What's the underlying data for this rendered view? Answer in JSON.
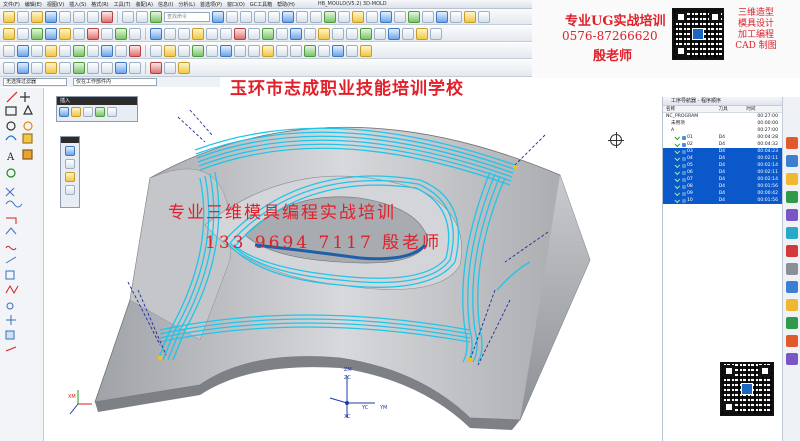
{
  "menubar": {
    "items": [
      "文件(F)",
      "编辑(E)",
      "视图(V)",
      "插入(S)",
      "格式(R)",
      "工具(T)",
      "装配(A)",
      "信息(I)",
      "分析(L)",
      "首选项(P)",
      "窗口(O)",
      "GC工具箱",
      "帮助(H)"
    ],
    "window_title": "HB_MOULD(V5.2)   3D-MOLD"
  },
  "toolbar": {
    "search_placeholder": "查找命令"
  },
  "filter": {
    "selection_filter": "无选择过滤器",
    "scope": "仅在工作部件内"
  },
  "banner": {
    "title": "专业UG实战培训",
    "phone": "0576-87266620",
    "name": "殷老师",
    "tags": [
      "三维造型",
      "模具设计",
      "加工编程",
      "CAD 制图"
    ]
  },
  "viewport": {
    "school_name": "玉环市志成职业技能培训学校",
    "watermark_line1": "专业三维模具编程实战培训",
    "watermark_line2": "133 9694 7117 殷老师",
    "axes": {
      "zm": "ZM",
      "zc": "ZC",
      "yc": "YC",
      "ym": "YM",
      "xc": "XC",
      "xm": "XM"
    }
  },
  "palette": {
    "title": "插入"
  },
  "navigator": {
    "title": "工序导航器 - 程序顺序",
    "columns": {
      "name": "名称",
      "tool": "刀具",
      "time": "时间"
    },
    "rows": [
      {
        "name": "NC_PROGRAM",
        "tool": "",
        "time": "00:27:00",
        "selected": false,
        "indent": 0
      },
      {
        "name": "未用项",
        "tool": "",
        "time": "00:00:00",
        "selected": false,
        "indent": 1
      },
      {
        "name": "A",
        "tool": "",
        "time": "00:27:00",
        "selected": false,
        "indent": 1
      },
      {
        "name": "01",
        "tool": "D4",
        "time": "00:04:28",
        "selected": false,
        "indent": 2
      },
      {
        "name": "02",
        "tool": "D4",
        "time": "00:04:32",
        "selected": false,
        "indent": 2
      },
      {
        "name": "03",
        "tool": "D4",
        "time": "00:04:23",
        "selected": true,
        "indent": 2
      },
      {
        "name": "04",
        "tool": "D4",
        "time": "00:02:11",
        "selected": true,
        "indent": 2
      },
      {
        "name": "05",
        "tool": "D4",
        "time": "00:02:14",
        "selected": true,
        "indent": 2
      },
      {
        "name": "06",
        "tool": "D4",
        "time": "00:02:11",
        "selected": true,
        "indent": 2
      },
      {
        "name": "07",
        "tool": "D4",
        "time": "00:02:14",
        "selected": true,
        "indent": 2
      },
      {
        "name": "08",
        "tool": "D4",
        "time": "00:01:56",
        "selected": true,
        "indent": 2
      },
      {
        "name": "09",
        "tool": "D4",
        "time": "00:00:42",
        "selected": true,
        "indent": 2
      },
      {
        "name": "10",
        "tool": "D4",
        "time": "00:01:56",
        "selected": true,
        "indent": 2
      }
    ]
  },
  "colors": {
    "promo_red": "#e0202a",
    "selection_blue": "#0a58c9",
    "toolpath_cyan": "#22c4e8",
    "part_gray": "#b7b9bd"
  }
}
